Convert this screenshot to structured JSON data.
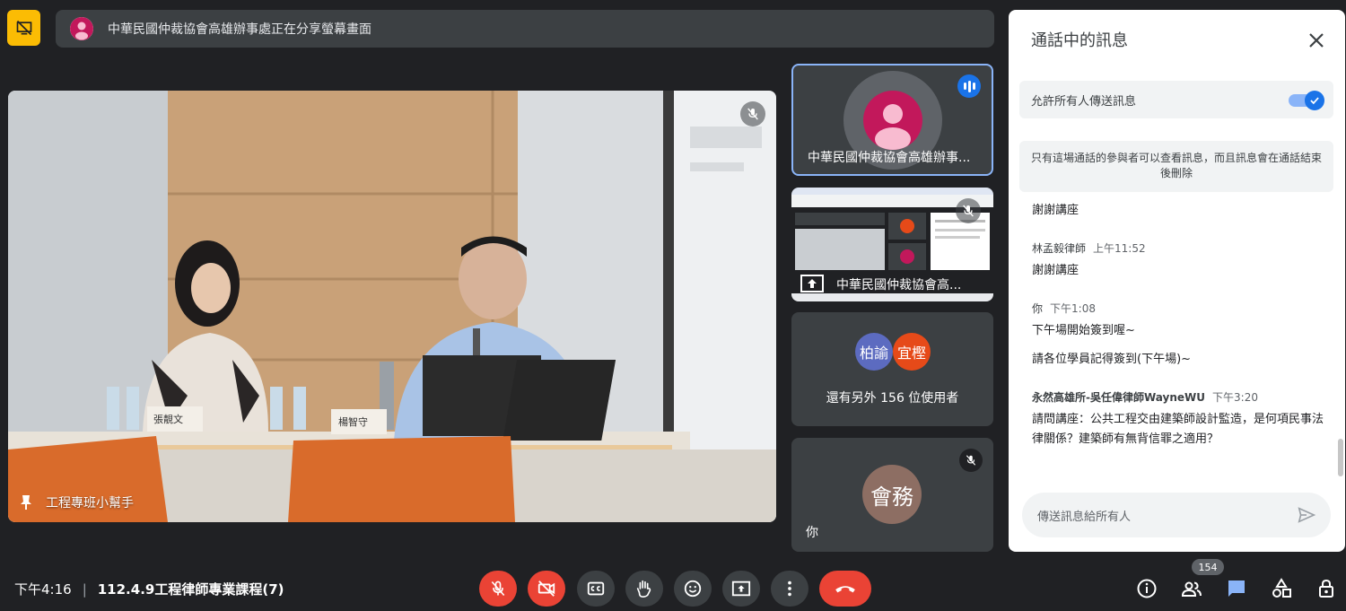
{
  "share_banner": {
    "text": "中華民國仲裁協會高雄辦事處正在分享螢幕畫面"
  },
  "main_video": {
    "name": "工程專班小幫手",
    "nameplates": [
      "張靚文",
      "楊智守"
    ]
  },
  "tiles": [
    {
      "name": "中華民國仲裁協會高雄辦事..."
    },
    {
      "name": "中華民國仲裁協會高..."
    },
    {
      "chips": [
        "柏諭",
        "宜樫"
      ],
      "chip_colors": [
        "#5c6bc0",
        "#e64a19"
      ],
      "others_text": "還有另外 156 位使用者"
    },
    {
      "chip": "會務",
      "chip_color": "#8d6e63",
      "name": "你"
    }
  ],
  "chat": {
    "title": "通話中的訊息",
    "allow_all": {
      "label": "允許所有人傳送訊息",
      "enabled": true
    },
    "info": "只有這場通話的參與者可以查看訊息，而且訊息會在通話結束後刪除",
    "messages": [
      {
        "sender": "",
        "time": "",
        "lines": [
          "謝謝講座"
        ]
      },
      {
        "sender": "林孟毅律師",
        "time": "上午11:52",
        "lines": [
          "謝謝講座"
        ]
      },
      {
        "sender": "你",
        "time": "下午1:08",
        "lines": [
          "下午場開始簽到喔~",
          "請各位學員記得簽到(下午場)~"
        ]
      },
      {
        "sender": "永然高雄所-吳任偉律師WayneWU",
        "time": "下午3:20",
        "lines": [
          "請問講座：公共工程交由建築師設計監造，是何項民事法律關係？建築師有無背信罪之適用？"
        ]
      }
    ],
    "input_placeholder": "傳送訊息給所有人"
  },
  "bottom": {
    "time": "下午4:16",
    "meeting_title": "112.4.9工程律師專業課程(7)",
    "participant_count": "154"
  },
  "colors": {
    "accent": "#1a73e8",
    "danger": "#ea4335",
    "present": "#fbbc04"
  }
}
